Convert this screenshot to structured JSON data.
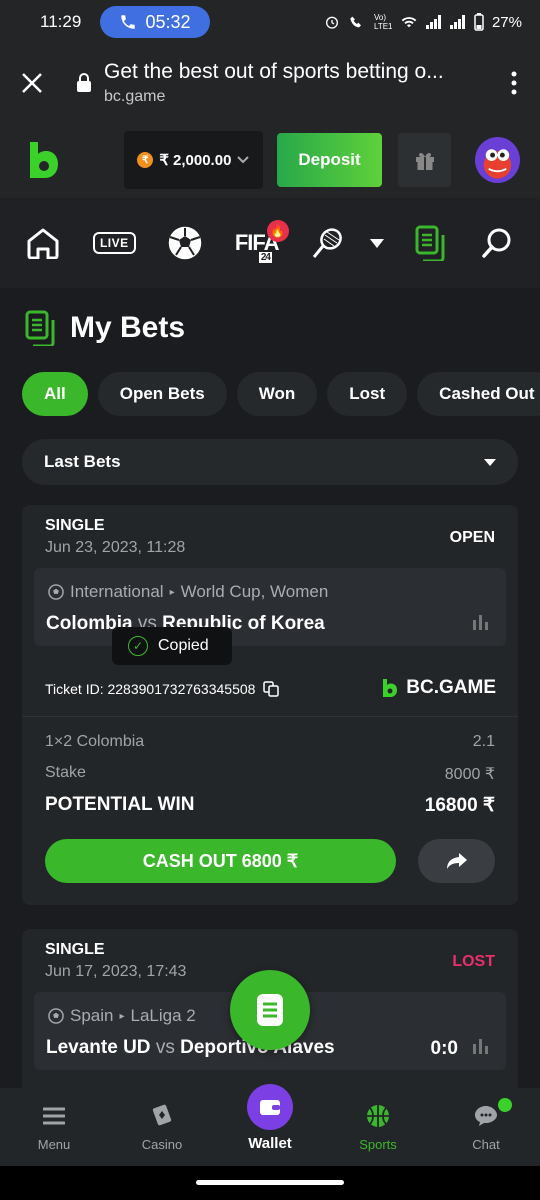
{
  "status_bar": {
    "time": "11:29",
    "call_timer": "05:32",
    "battery": "27%",
    "lte_label": "Vo) LTE1"
  },
  "browser": {
    "page_title": "Get the best out of sports betting o...",
    "url": "bc.game"
  },
  "header": {
    "balance": "₹ 2,000.00",
    "deposit_label": "Deposit"
  },
  "nav": {
    "live_label": "LIVE",
    "fifa_label": "FIFA",
    "fifa_year": "24"
  },
  "main": {
    "title": "My Bets",
    "filters": [
      "All",
      "Open Bets",
      "Won",
      "Lost",
      "Cashed Out"
    ],
    "select_value": "Last Bets"
  },
  "bets": [
    {
      "type": "SINGLE",
      "date": "Jun 23, 2023, 11:28",
      "status": "OPEN",
      "league_country": "International",
      "league_name": "World Cup, Women",
      "home": "Colombia",
      "vs": "vs",
      "away": "Republic of Korea",
      "ticket_id": "Ticket ID: 2283901732763345508",
      "brand": "BC.GAME",
      "selection": "1×2 Colombia",
      "odds": "2.1",
      "stake_label": "Stake",
      "stake": "8000 ₹",
      "potential_label": "POTENTIAL WIN",
      "potential": "16800 ₹",
      "cashout": "CASH OUT 6800 ₹",
      "toast": "Copied"
    },
    {
      "type": "SINGLE",
      "date": "Jun 17, 2023, 17:43",
      "status": "LOST",
      "league_country": "Spain",
      "league_name": "LaLiga 2",
      "home": "Levante UD",
      "vs": "vs",
      "away": "Deportivo Alaves",
      "score": "0:0"
    }
  ],
  "bottom_nav": [
    "Menu",
    "Casino",
    "Wallet",
    "Sports",
    "Chat"
  ],
  "colors": {
    "accent": "#3bb72b",
    "lost": "#e8306a",
    "wallet": "#7b3fe4"
  }
}
